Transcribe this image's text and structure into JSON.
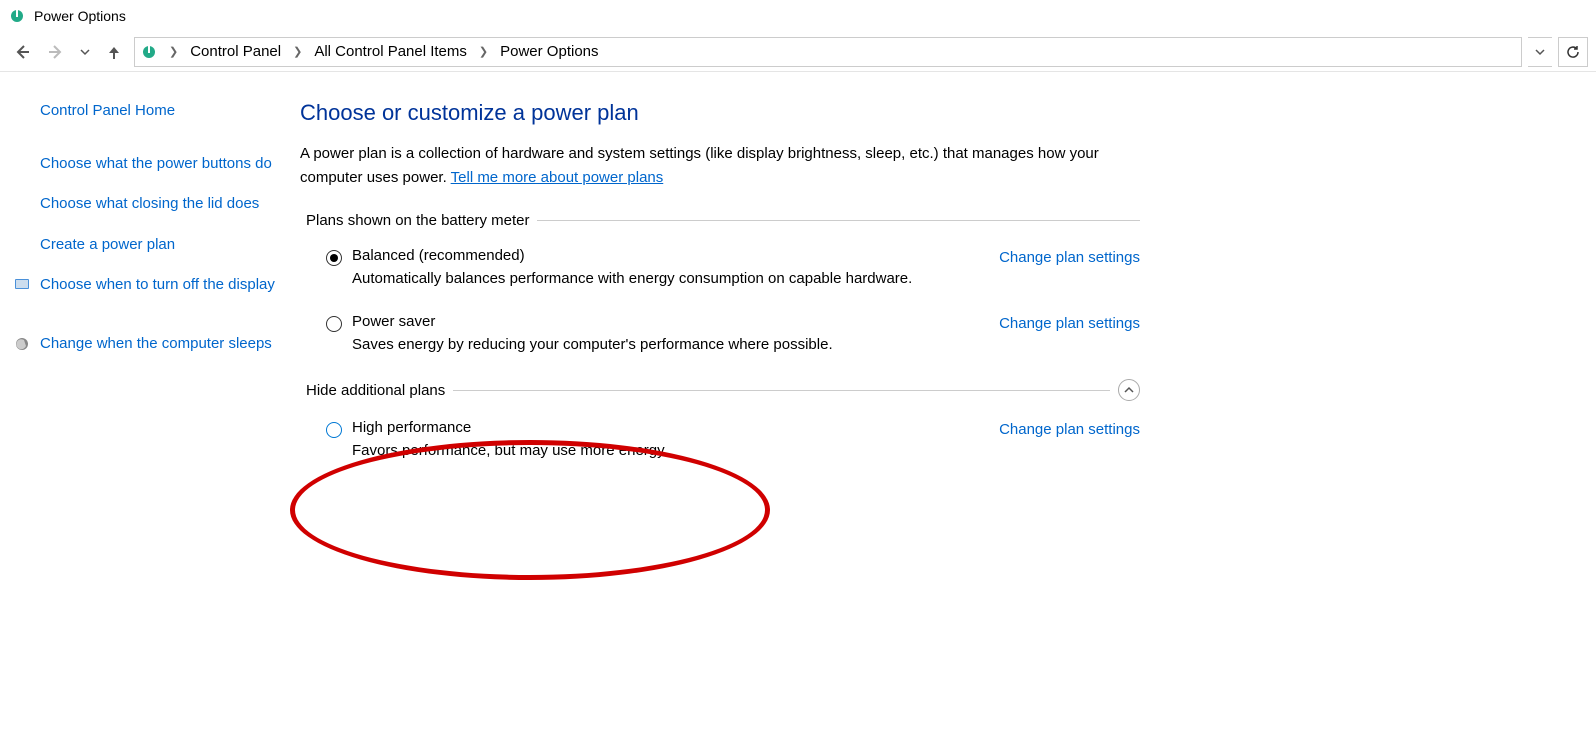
{
  "window": {
    "title": "Power Options"
  },
  "breadcrumb": {
    "items": [
      "Control Panel",
      "All Control Panel Items",
      "Power Options"
    ]
  },
  "sidebar": {
    "home": "Control Panel Home",
    "links": [
      "Choose what the power buttons do",
      "Choose what closing the lid does",
      "Create a power plan",
      "Choose when to turn off the display",
      "Change when the computer sleeps"
    ]
  },
  "main": {
    "heading": "Choose or customize a power plan",
    "intro_1": "A power plan is a collection of hardware and system settings (like display brightness, sleep, etc.) that manages how your computer uses power. ",
    "intro_link": "Tell me more about power plans",
    "section1": "Plans shown on the battery meter",
    "section2": "Hide additional plans",
    "change_label": "Change plan settings",
    "plans_primary": [
      {
        "name": "Balanced (recommended)",
        "desc": "Automatically balances performance with energy consumption on capable hardware.",
        "selected": true
      },
      {
        "name": "Power saver",
        "desc": "Saves energy by reducing your computer's performance where possible.",
        "selected": false
      }
    ],
    "plans_additional": [
      {
        "name": "High performance",
        "desc": "Favors performance, but may use more energy.",
        "selected": false
      }
    ]
  }
}
